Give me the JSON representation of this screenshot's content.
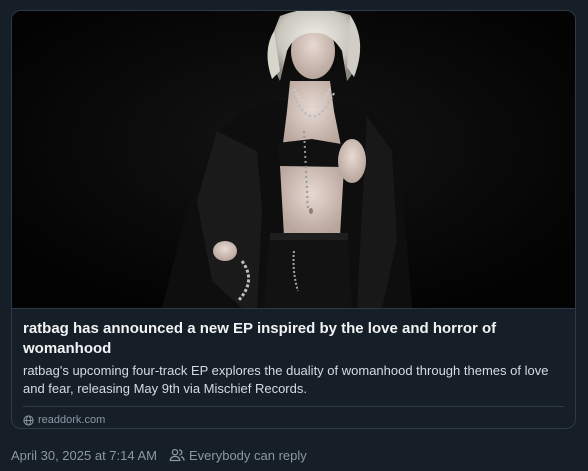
{
  "link_card": {
    "title": "ratbag has announced a new EP inspired by the love and horror of womanhood",
    "description": "ratbag's upcoming four-track EP explores the duality of womanhood through themes of love and fear, releasing May 9th via Mischief Records.",
    "domain": "readdork.com",
    "image_icon": "photo-thumbnail",
    "domain_icon": "globe-icon"
  },
  "post_footer": {
    "timestamp": "April 30, 2025 at 7:14 AM",
    "reply_setting": "Everybody can reply",
    "reply_icon": "people-icon"
  },
  "colors": {
    "background": "#161e27",
    "border": "#2e3a48",
    "muted_text": "#8b98a5"
  }
}
